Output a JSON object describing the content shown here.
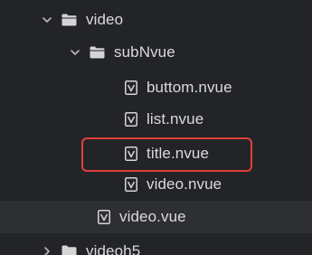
{
  "tree": {
    "items": [
      {
        "label": "video",
        "type": "folder",
        "expanded": true,
        "icon": "folder-icon"
      },
      {
        "label": "subNvue",
        "type": "folder",
        "expanded": true,
        "icon": "folder-icon"
      },
      {
        "label": "buttom.nvue",
        "type": "file",
        "icon": "vue-file-icon"
      },
      {
        "label": "list.nvue",
        "type": "file",
        "icon": "vue-file-icon"
      },
      {
        "label": "title.nvue",
        "type": "file",
        "icon": "vue-file-icon",
        "highlighted": true
      },
      {
        "label": "video.nvue",
        "type": "file",
        "icon": "vue-file-icon"
      },
      {
        "label": "video.vue",
        "type": "file",
        "icon": "vue-file-icon",
        "selected": true
      },
      {
        "label": "videoh5",
        "type": "folder",
        "expanded": false,
        "icon": "folder-icon"
      }
    ]
  },
  "colors": {
    "background": "#232427",
    "selected_row": "#2e2f33",
    "text": "#d9dadc",
    "highlight_border": "#e0403a"
  }
}
